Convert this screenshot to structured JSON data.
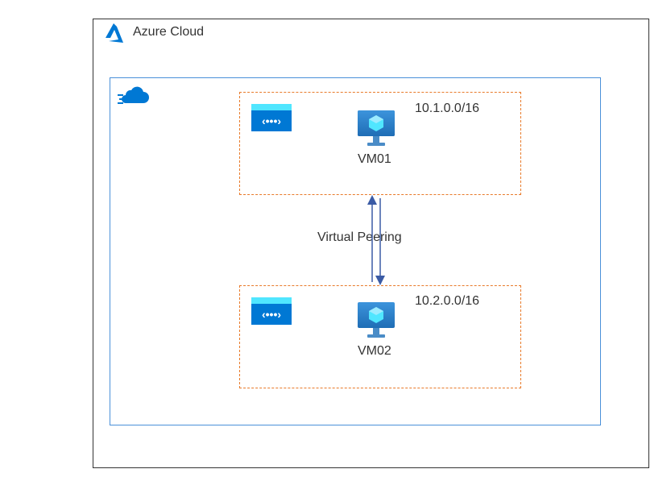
{
  "title": "Azure Cloud",
  "peering_label": "Virtual Peering",
  "vnets": [
    {
      "cidr": "10.1.0.0/16",
      "vm_name": "VM01"
    },
    {
      "cidr": "10.2.0.0/16",
      "vm_name": "VM02"
    }
  ],
  "icons": {
    "vnet_glyph": "‹•••›"
  },
  "colors": {
    "outer_border": "#333333",
    "inner_border": "#4a90d9",
    "vnet_border": "#e87a2a",
    "azure_blue": "#0078d4",
    "azure_light": "#50e6ff",
    "arrow": "#3b5ba5"
  },
  "chart_data": {
    "type": "diagram",
    "title": "Azure Cloud",
    "nodes": [
      {
        "id": "vnet1",
        "type": "virtual-network",
        "cidr": "10.1.0.0/16",
        "contains": [
          "VM01"
        ]
      },
      {
        "id": "vnet2",
        "type": "virtual-network",
        "cidr": "10.2.0.0/16",
        "contains": [
          "VM02"
        ]
      },
      {
        "id": "VM01",
        "type": "virtual-machine"
      },
      {
        "id": "VM02",
        "type": "virtual-machine"
      }
    ],
    "edges": [
      {
        "from": "vnet1",
        "to": "vnet2",
        "label": "Virtual Peering",
        "bidirectional": true
      }
    ]
  }
}
